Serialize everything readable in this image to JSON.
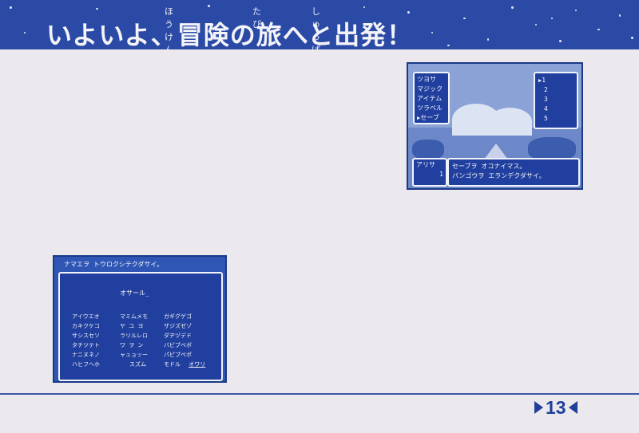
{
  "header": {
    "ruby_hoken": "ほうけん",
    "ruby_tabi": "たび",
    "ruby_shuppatsu": "しゅっぱつ",
    "title": "いよいよ、冒険の旅へと出発！"
  },
  "page": {
    "number": "13"
  },
  "screen1": {
    "menu": [
      "ツヨサ",
      "マジック",
      "アイテム",
      "ツラベル",
      "セーブ"
    ],
    "slots": [
      "1",
      "2",
      "3",
      "4",
      "5"
    ],
    "party_name": "アリサ",
    "party_stat": "1",
    "message_line1": "セーブヲ オコナイマス。",
    "message_line2": "バンゴウヲ エランデクダサイ。"
  },
  "screen2": {
    "prompt": "ナマエヲ トウロクシテクダサイ。",
    "entered_name": "オサール_",
    "col1": [
      "アイウエオ",
      "カキクケコ",
      "サシスセソ",
      "タチツテト",
      "ナニヌネノ",
      "ハヒフヘホ"
    ],
    "col2": [
      "マミムメモ",
      "ヤ ユ ヨ",
      "ラリルレロ",
      "ワ ヲ ン",
      "ャュョッー",
      "スズム"
    ],
    "col3": [
      "ガギグゲゴ",
      "ザジズゼゾ",
      "ダヂヅデド",
      "バビブベボ",
      "パピプペポ",
      "モドル"
    ],
    "end_label": "オワリ"
  }
}
